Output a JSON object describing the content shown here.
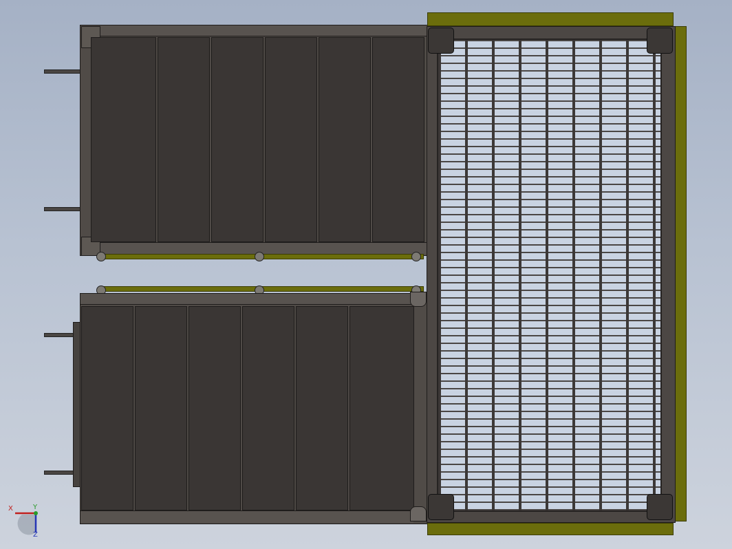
{
  "viewport": {
    "title": "",
    "parts": {
      "upper_door": "upper-door-assembly",
      "lower_door": "lower-door-assembly",
      "grating_frame": "grating-frame-assembly"
    },
    "triad": {
      "x_label": "X",
      "y_label": "Y",
      "z_label": "Z",
      "x_color": "#c0201e",
      "y_color": "#2a9a2a",
      "z_color": "#2535b5"
    },
    "colors": {
      "panel": "#3a3634",
      "frame": "#504b47",
      "olive": "#6b6d0c",
      "grating_bg": "#c9d3e2"
    }
  }
}
